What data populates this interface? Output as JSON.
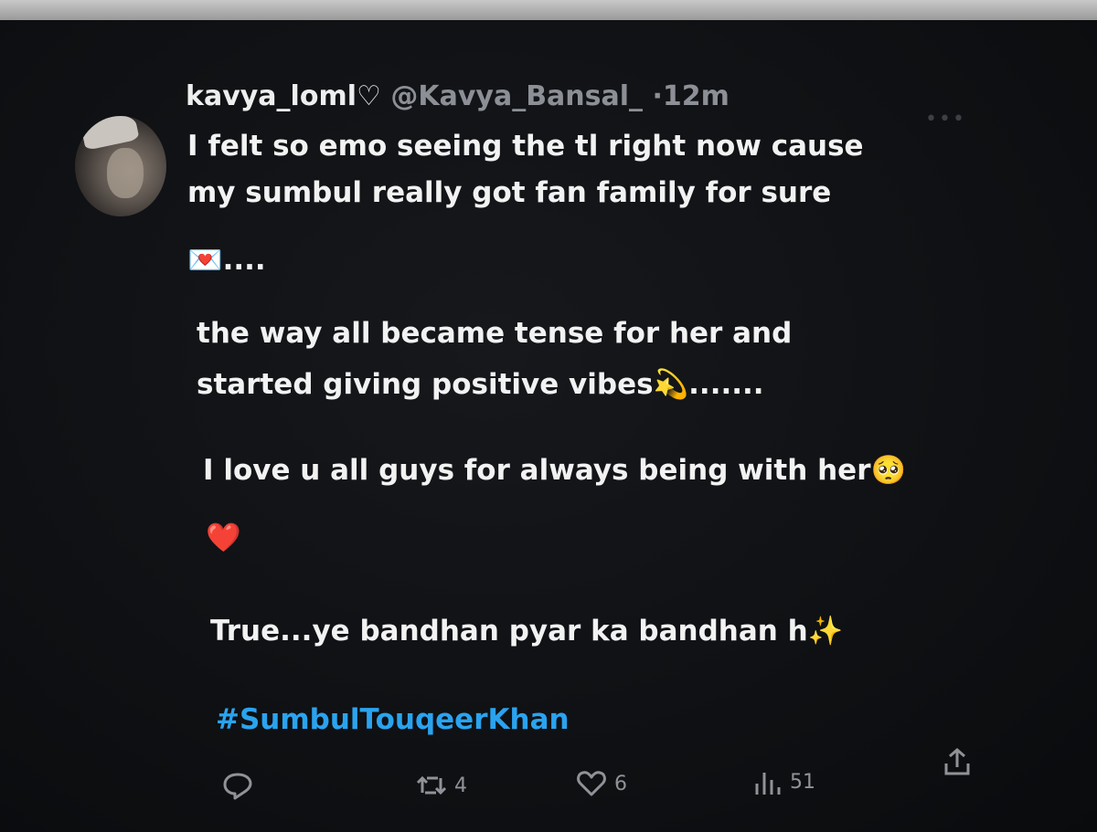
{
  "tweet": {
    "display_name": "kavya_loml♡",
    "handle": "@Kavya_Bansal_",
    "time": "·12m",
    "lines": [
      "I felt so emo seeing the tl right now cause",
      "my sumbul really got fan family for sure",
      "💌....",
      "the way all became tense for her and",
      "started giving positive vibes💫.......",
      "I love u all guys for always being with her🥺",
      "❤️",
      "True...ye bandhan pyar ka bandhan h✨"
    ],
    "hashtag": "#SumbulTouqeerKhan"
  },
  "actions": {
    "reply_icon": "reply-icon",
    "retweet_icon": "retweet-icon",
    "retweet_count": "4",
    "like_icon": "heart-icon",
    "like_count": "6",
    "views_icon": "views-icon",
    "views_count": "51",
    "share_icon": "share-icon"
  },
  "colors": {
    "background": "#0d0f12",
    "text": "#f2f2f2",
    "secondary": "#8c9096",
    "hashtag": "#2aa3ef"
  }
}
